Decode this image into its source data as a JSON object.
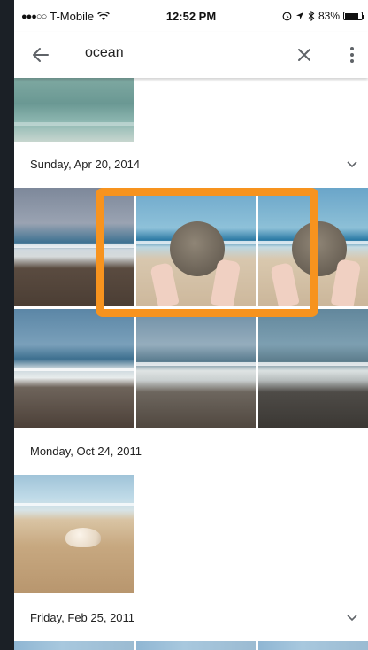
{
  "status_bar": {
    "carrier": "T-Mobile",
    "signal": "●●●○○",
    "time": "12:52 PM",
    "battery_percent": "83%",
    "battery_level": 0.83
  },
  "search": {
    "query": "ocean"
  },
  "sections": [
    {
      "date": "Sunday, Apr 20, 2014"
    },
    {
      "date": "Monday, Oct 24, 2011"
    },
    {
      "date": "Friday, Feb 25, 2011"
    }
  ],
  "highlight": {
    "color": "#f7931e"
  },
  "icons": {
    "back": "arrow-left",
    "clear": "close-x",
    "more": "vertical-dots",
    "expand": "chevron-down"
  }
}
